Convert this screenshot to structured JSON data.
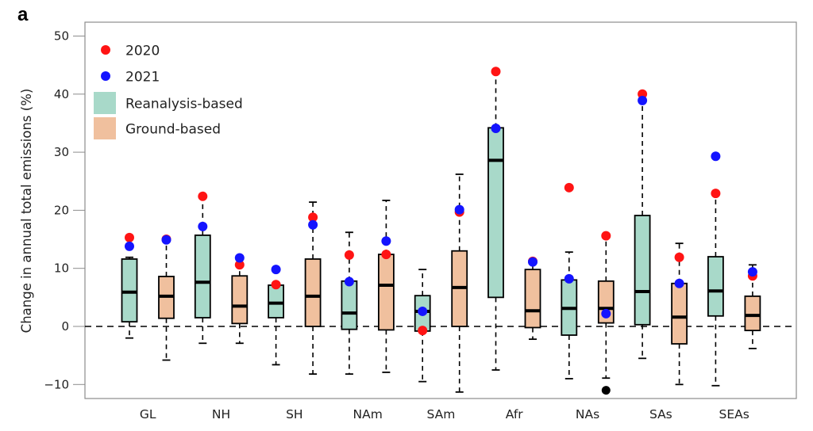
{
  "panel_label": "a",
  "colors": {
    "y2020": "#ff1414",
    "y2021": "#1414ff",
    "reanalysis": "#a8d9c9",
    "ground": "#f0c09e",
    "outlier": "#000000",
    "frame": "#8c8c8c"
  },
  "chart_data": {
    "type": "boxplot",
    "title": "",
    "xlabel": "",
    "ylabel": "Change in annual total emissions (%)",
    "ylim": [
      -12.5,
      52.5
    ],
    "yticks": [
      -10,
      0,
      10,
      20,
      30,
      40,
      50
    ],
    "ytick_labels": [
      "−10",
      "0",
      "10",
      "20",
      "30",
      "40",
      "50"
    ],
    "reference_line": {
      "y": 0,
      "style": "dashed"
    },
    "categories": [
      "GL",
      "NH",
      "SH",
      "NAm",
      "SAm",
      "Afr",
      "NAs",
      "SAs",
      "SEAs"
    ],
    "legend": {
      "placement": "top-left",
      "entries": [
        {
          "label": "2020",
          "kind": "dot",
          "color_key": "y2020"
        },
        {
          "label": "2021",
          "kind": "dot",
          "color_key": "y2021"
        },
        {
          "label": "Reanalysis-based",
          "kind": "box",
          "color_key": "reanalysis"
        },
        {
          "label": "Ground-based",
          "kind": "box",
          "color_key": "ground"
        }
      ]
    },
    "series": [
      {
        "name": "Reanalysis-based",
        "color_key": "reanalysis",
        "boxes": [
          {
            "category": "GL",
            "whisker_low": -2.0,
            "q1": 0.8,
            "median": 5.9,
            "q3": 11.6,
            "whisker_high": 11.9,
            "v2020": 15.3,
            "v2021": 13.8,
            "outliers": []
          },
          {
            "category": "NH",
            "whisker_low": -2.9,
            "q1": 1.5,
            "median": 7.6,
            "q3": 15.7,
            "whisker_high": 22.3,
            "v2020": 22.4,
            "v2021": 17.2,
            "outliers": []
          },
          {
            "category": "SH",
            "whisker_low": -6.6,
            "q1": 1.5,
            "median": 4.0,
            "q3": 7.1,
            "whisker_high": 7.1,
            "v2020": 7.2,
            "v2021": 9.8,
            "outliers": []
          },
          {
            "category": "NAm",
            "whisker_low": -8.2,
            "q1": -0.5,
            "median": 2.3,
            "q3": 7.8,
            "whisker_high": 16.2,
            "v2020": 12.3,
            "v2021": 7.7,
            "outliers": []
          },
          {
            "category": "SAm",
            "whisker_low": -9.5,
            "q1": -0.8,
            "median": 2.6,
            "q3": 5.3,
            "whisker_high": 9.8,
            "v2020": -0.7,
            "v2021": 2.6,
            "outliers": []
          },
          {
            "category": "Afr",
            "whisker_low": -7.5,
            "q1": 5.0,
            "median": 28.6,
            "q3": 34.2,
            "whisker_high": 43.9,
            "v2020": 43.9,
            "v2021": 34.1,
            "outliers": []
          },
          {
            "category": "NAs",
            "whisker_low": -9.0,
            "q1": -1.5,
            "median": 3.1,
            "q3": 8.0,
            "whisker_high": 12.8,
            "v2020": 23.9,
            "v2021": 8.2,
            "outliers": []
          },
          {
            "category": "SAs",
            "whisker_low": -5.5,
            "q1": 0.3,
            "median": 6.0,
            "q3": 19.1,
            "whisker_high": 39.0,
            "v2020": 40.0,
            "v2021": 38.9,
            "outliers": []
          },
          {
            "category": "SEAs",
            "whisker_low": -10.2,
            "q1": 1.8,
            "median": 6.1,
            "q3": 12.0,
            "whisker_high": 22.9,
            "v2020": 22.9,
            "v2021": 29.3,
            "outliers": []
          }
        ]
      },
      {
        "name": "Ground-based",
        "color_key": "ground",
        "boxes": [
          {
            "category": "GL",
            "whisker_low": -5.8,
            "q1": 1.4,
            "median": 5.2,
            "q3": 8.6,
            "whisker_high": 14.9,
            "v2020": 15.0,
            "v2021": 14.9,
            "outliers": []
          },
          {
            "category": "NH",
            "whisker_low": -2.9,
            "q1": 0.5,
            "median": 3.5,
            "q3": 8.7,
            "whisker_high": 10.8,
            "v2020": 10.6,
            "v2021": 11.8,
            "outliers": []
          },
          {
            "category": "SH",
            "whisker_low": -8.2,
            "q1": 0.0,
            "median": 5.2,
            "q3": 11.6,
            "whisker_high": 21.4,
            "v2020": 18.8,
            "v2021": 17.5,
            "outliers": []
          },
          {
            "category": "NAm",
            "whisker_low": -7.9,
            "q1": -0.6,
            "median": 7.1,
            "q3": 12.4,
            "whisker_high": 21.7,
            "v2020": 12.4,
            "v2021": 14.7,
            "outliers": []
          },
          {
            "category": "SAm",
            "whisker_low": -11.3,
            "q1": 0.0,
            "median": 6.7,
            "q3": 13.0,
            "whisker_high": 26.2,
            "v2020": 19.7,
            "v2021": 20.1,
            "outliers": []
          },
          {
            "category": "Afr",
            "whisker_low": -2.2,
            "q1": -0.2,
            "median": 2.7,
            "q3": 9.8,
            "whisker_high": 11.2,
            "v2020": 11.2,
            "v2021": 11.1,
            "outliers": []
          },
          {
            "category": "NAs",
            "whisker_low": -8.9,
            "q1": 0.6,
            "median": 3.1,
            "q3": 7.8,
            "whisker_high": 15.4,
            "v2020": 15.6,
            "v2021": 2.2,
            "outliers": [
              -11.0
            ]
          },
          {
            "category": "SAs",
            "whisker_low": -10.0,
            "q1": -3.0,
            "median": 1.6,
            "q3": 7.4,
            "whisker_high": 14.3,
            "v2020": 11.9,
            "v2021": 7.4,
            "outliers": []
          },
          {
            "category": "SEAs",
            "whisker_low": -3.8,
            "q1": -0.7,
            "median": 1.9,
            "q3": 5.2,
            "whisker_high": 10.6,
            "v2020": 8.7,
            "v2021": 9.4,
            "outliers": []
          }
        ]
      }
    ]
  }
}
